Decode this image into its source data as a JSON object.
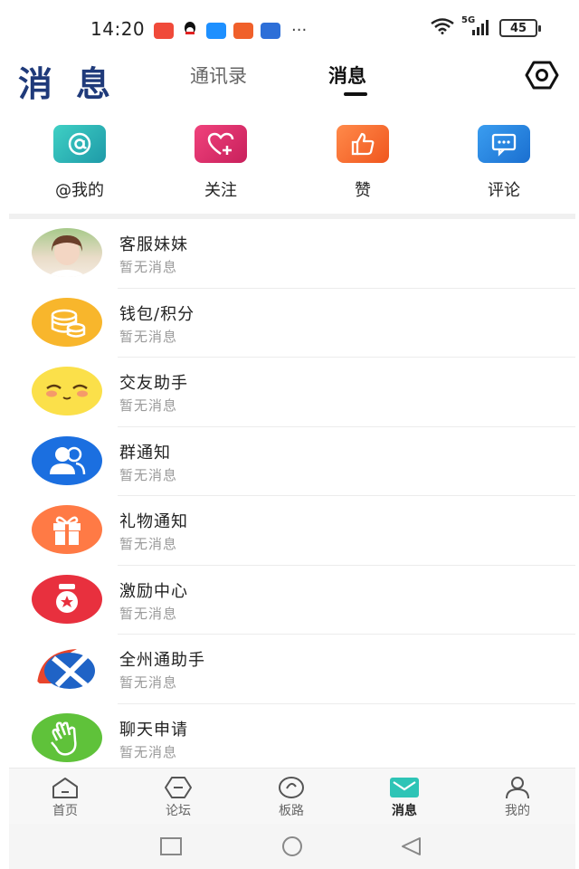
{
  "status_bar": {
    "time": "14:20",
    "network": "5G",
    "battery": "45",
    "apps": [
      "weibo-app-icon",
      "qq-app-icon",
      "chat-app-icon",
      "photo-app-icon",
      "browser-app-icon"
    ],
    "more": "···"
  },
  "header": {
    "logo": "消息",
    "tabs": [
      {
        "label": "通讯录",
        "active": false
      },
      {
        "label": "消息",
        "active": true
      }
    ],
    "settings_icon": "settings-hexagon-icon"
  },
  "quick_actions": [
    {
      "label": "@我的",
      "icon": "at-icon",
      "color": "#2bb5b0"
    },
    {
      "label": "关注",
      "icon": "heart-plus-icon",
      "color": "#e0336d"
    },
    {
      "label": "赞",
      "icon": "thumbs-up-icon",
      "color": "#ff6a33"
    },
    {
      "label": "评论",
      "icon": "comment-icon",
      "color": "#1e7fe0"
    }
  ],
  "messages": [
    {
      "title": "客服妹妹",
      "subtitle": "暂无消息",
      "icon": "customer-service-avatar"
    },
    {
      "title": "钱包/积分",
      "subtitle": "暂无消息",
      "icon": "wallet-coins-icon"
    },
    {
      "title": "交友助手",
      "subtitle": "暂无消息",
      "icon": "smiley-face-icon"
    },
    {
      "title": "群通知",
      "subtitle": "暂无消息",
      "icon": "group-icon"
    },
    {
      "title": "礼物通知",
      "subtitle": "暂无消息",
      "icon": "gift-icon"
    },
    {
      "title": "激励中心",
      "subtitle": "暂无消息",
      "icon": "medal-icon"
    },
    {
      "title": "全州通助手",
      "subtitle": "暂无消息",
      "icon": "quanzhou-logo-icon"
    },
    {
      "title": "聊天申请",
      "subtitle": "暂无消息",
      "icon": "wave-hand-icon"
    }
  ],
  "tab_bar": [
    {
      "label": "首页",
      "icon": "home-icon",
      "active": false
    },
    {
      "label": "论坛",
      "icon": "forum-icon",
      "active": false
    },
    {
      "label": "板路",
      "icon": "banlu-icon",
      "active": false
    },
    {
      "label": "消息",
      "icon": "mail-icon",
      "active": true
    },
    {
      "label": "我的",
      "icon": "profile-icon",
      "active": false
    }
  ],
  "colors": {
    "accent": "#2ec4b6",
    "logo": "#1f3a7a",
    "subtitle": "#9a9a9a"
  }
}
